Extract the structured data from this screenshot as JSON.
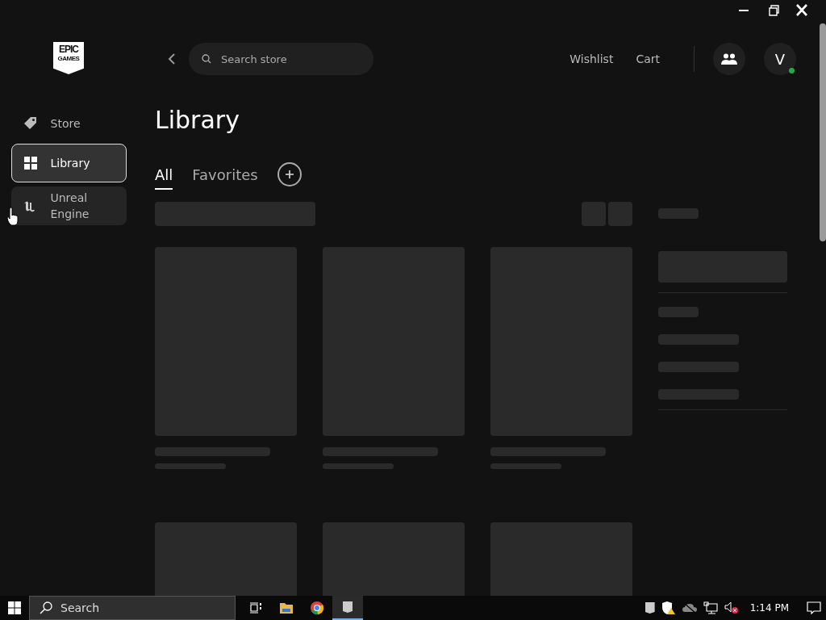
{
  "logo": {
    "line1": "EPIC",
    "line2": "GAMES"
  },
  "sidebar": {
    "items": [
      {
        "label": "Store",
        "selected": false,
        "hovered": false
      },
      {
        "label": "Library",
        "selected": true,
        "hovered": false
      },
      {
        "label": "Unreal Engine",
        "selected": false,
        "hovered": true
      }
    ]
  },
  "topbar": {
    "search": {
      "placeholder": "Search store"
    },
    "links": [
      "Wishlist",
      "Cart"
    ],
    "avatar": {
      "initial": "V",
      "online": true
    }
  },
  "page": {
    "title": "Library",
    "tabs": [
      {
        "label": "All",
        "selected": true
      },
      {
        "label": "Favorites",
        "selected": false
      }
    ],
    "loading": true
  },
  "taskbar": {
    "search": {
      "placeholder": "Search"
    },
    "clock": "1:14 PM"
  }
}
